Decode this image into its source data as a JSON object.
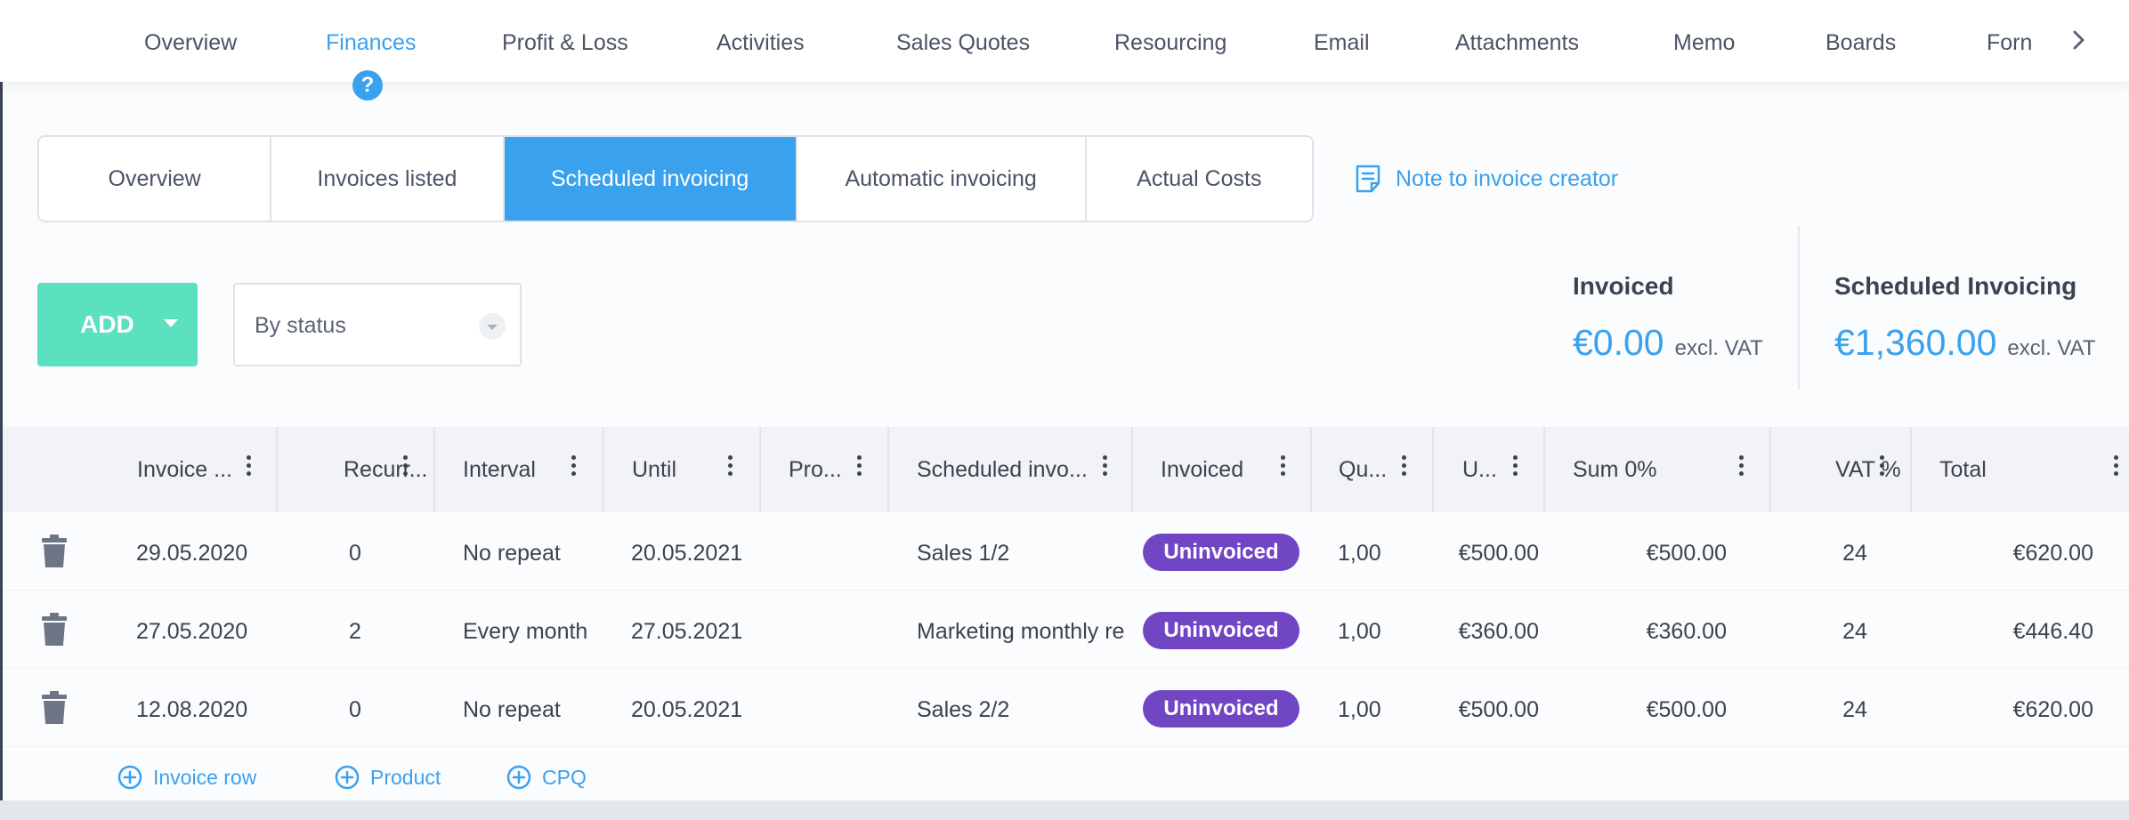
{
  "nav": {
    "tabs": [
      {
        "label": "Overview"
      },
      {
        "label": "Finances"
      },
      {
        "label": "Profit & Loss"
      },
      {
        "label": "Activities"
      },
      {
        "label": "Sales Quotes"
      },
      {
        "label": "Resourcing"
      },
      {
        "label": "Email"
      },
      {
        "label": "Attachments"
      },
      {
        "label": "Memo"
      },
      {
        "label": "Boards"
      },
      {
        "label": "Forn"
      }
    ],
    "active_tab": "Finances",
    "help_badge": "?"
  },
  "subtabs": {
    "items": [
      {
        "label": "Overview"
      },
      {
        "label": "Invoices listed"
      },
      {
        "label": "Scheduled invoicing"
      },
      {
        "label": "Automatic invoicing"
      },
      {
        "label": "Actual Costs"
      }
    ],
    "active": "Scheduled invoicing"
  },
  "note_link": "Note to invoice creator",
  "toolbar": {
    "add_label": "ADD",
    "status_filter": "By status"
  },
  "totals": {
    "invoiced": {
      "label": "Invoiced",
      "amount": "€0.00",
      "unit": "excl. VAT"
    },
    "scheduled": {
      "label": "Scheduled Invoicing",
      "amount": "€1,360.00",
      "unit": "excl. VAT"
    }
  },
  "table": {
    "columns": [
      {
        "label": "Invoice ..."
      },
      {
        "label": "Recurr..."
      },
      {
        "label": "Interval"
      },
      {
        "label": "Until"
      },
      {
        "label": "Pro..."
      },
      {
        "label": "Scheduled invo..."
      },
      {
        "label": "Invoiced"
      },
      {
        "label": "Qu..."
      },
      {
        "label": "U..."
      },
      {
        "label": "Sum 0%"
      },
      {
        "label": "VAT %"
      },
      {
        "label": "Total"
      }
    ],
    "rows": [
      {
        "date": "29.05.2020",
        "recurrence": "0",
        "interval": "No repeat",
        "until": "20.05.2021",
        "product": "",
        "description": "Sales 1/2",
        "status": "Uninvoiced",
        "quantity": "1,00",
        "unit_price": "€500.00",
        "sum": "€500.00",
        "vat": "24",
        "total": "€620.00"
      },
      {
        "date": "27.05.2020",
        "recurrence": "2",
        "interval": "Every month",
        "until": "27.05.2021",
        "product": "",
        "description": "Marketing monthly re",
        "status": "Uninvoiced",
        "quantity": "1,00",
        "unit_price": "€360.00",
        "sum": "€360.00",
        "vat": "24",
        "total": "€446.40"
      },
      {
        "date": "12.08.2020",
        "recurrence": "0",
        "interval": "No repeat",
        "until": "20.05.2021",
        "product": "",
        "description": "Sales 2/2",
        "status": "Uninvoiced",
        "quantity": "1,00",
        "unit_price": "€500.00",
        "sum": "€500.00",
        "vat": "24",
        "total": "€620.00"
      }
    ]
  },
  "add_links": [
    {
      "label": "Invoice row"
    },
    {
      "label": "Product"
    },
    {
      "label": "CPQ"
    }
  ],
  "colors": {
    "accent": "#3aa1ef",
    "add_button": "#5be0c0",
    "status_badge": "#7046c4"
  }
}
